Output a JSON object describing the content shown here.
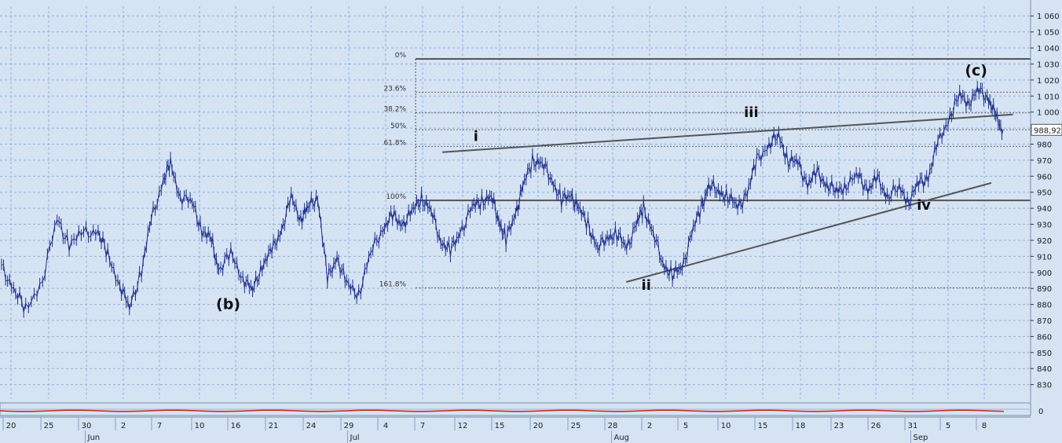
{
  "chart_data": {
    "type": "line",
    "y_axis": {
      "side": "right",
      "ylim": [
        821,
        1066
      ],
      "ticks": [
        830,
        840,
        850,
        860,
        870,
        880,
        890,
        900,
        910,
        920,
        930,
        940,
        950,
        960,
        970,
        980,
        990,
        1000,
        1010,
        1020,
        1030,
        1040,
        1050,
        1060
      ],
      "tick_labels": [
        "830",
        "840",
        "850",
        "860",
        "870",
        "880",
        "890",
        "900",
        "910",
        "920",
        "930",
        "940",
        "950",
        "960",
        "970",
        "980",
        "990",
        "1 000",
        "1 010",
        "1 020",
        "1 030",
        "1 040",
        "1 050",
        "1 060"
      ],
      "current_value_label": "988,92",
      "current_value": 988.92
    },
    "x_axis": {
      "day_ticks": [
        "20",
        "25",
        "30",
        "2",
        "7",
        "10",
        "16",
        "21",
        "24",
        "29",
        "4",
        "7",
        "12",
        "15",
        "20",
        "25",
        "28",
        "2",
        "5",
        "10",
        "15",
        "18",
        "23",
        "26",
        "31",
        "5",
        "8"
      ],
      "month_labels": [
        {
          "label": "Jun",
          "after_tick": 2
        },
        {
          "label": "Jul",
          "after_tick": 9
        },
        {
          "label": "Aug",
          "after_tick": 16
        },
        {
          "label": "Sep",
          "after_tick": 24
        }
      ]
    },
    "series": [
      {
        "values": [
          [
            0,
            903
          ],
          [
            0.5,
            890
          ],
          [
            1,
            876
          ],
          [
            1.7,
            896
          ],
          [
            2.3,
            933
          ],
          [
            2.8,
            918
          ],
          [
            3.4,
            924
          ],
          [
            4,
            926
          ],
          [
            4.4,
            910
          ],
          [
            4.9,
            893
          ],
          [
            5.3,
            877
          ],
          [
            5.8,
            902
          ],
          [
            6.2,
            932
          ],
          [
            6.7,
            958
          ],
          [
            7,
            967
          ],
          [
            7.4,
            948
          ],
          [
            7.9,
            943
          ],
          [
            8.3,
            927
          ],
          [
            8.7,
            919
          ],
          [
            9,
            902
          ],
          [
            9.5,
            911
          ],
          [
            10,
            897
          ],
          [
            10.4,
            888
          ],
          [
            10.8,
            905
          ],
          [
            11.2,
            913
          ],
          [
            11.6,
            927
          ],
          [
            12,
            946
          ],
          [
            12.4,
            934
          ],
          [
            12.7,
            940
          ],
          [
            13.1,
            948
          ],
          [
            13.5,
            895
          ],
          [
            13.9,
            910
          ],
          [
            14.3,
            892
          ],
          [
            14.8,
            887
          ],
          [
            15.3,
            912
          ],
          [
            15.8,
            928
          ],
          [
            16.2,
            935
          ],
          [
            16.6,
            930
          ],
          [
            17,
            937
          ],
          [
            17.4,
            947
          ],
          [
            17.8,
            938
          ],
          [
            18.2,
            920
          ],
          [
            18.6,
            913
          ],
          [
            19,
            925
          ],
          [
            19.5,
            940
          ],
          [
            19.9,
            945
          ],
          [
            20.3,
            947
          ],
          [
            20.6,
            933
          ],
          [
            20.9,
            920
          ],
          [
            21.3,
            937
          ],
          [
            21.6,
            953
          ],
          [
            22,
            970
          ],
          [
            22.4,
            968
          ],
          [
            22.8,
            958
          ],
          [
            23.2,
            945
          ],
          [
            23.6,
            948
          ],
          [
            23.9,
            940
          ],
          [
            24.3,
            930
          ],
          [
            24.7,
            915
          ],
          [
            25.1,
            922
          ],
          [
            25.5,
            924
          ],
          [
            25.9,
            915
          ],
          [
            26.3,
            930
          ],
          [
            26.6,
            940
          ],
          [
            27,
            925
          ],
          [
            27.4,
            905
          ],
          [
            27.8,
            899
          ],
          [
            28.2,
            902
          ],
          [
            28.6,
            925
          ],
          [
            29,
            940
          ],
          [
            29.3,
            955
          ],
          [
            29.7,
            950
          ],
          [
            30.1,
            948
          ],
          [
            30.5,
            940
          ],
          [
            30.9,
            950
          ],
          [
            31.3,
            970
          ],
          [
            31.8,
            980
          ],
          [
            32.2,
            985
          ],
          [
            32.6,
            970
          ],
          [
            33,
            968
          ],
          [
            33.4,
            955
          ],
          [
            33.8,
            962
          ],
          [
            34.2,
            955
          ],
          [
            34.6,
            950
          ],
          [
            35,
            955
          ],
          [
            35.5,
            960
          ],
          [
            35.9,
            952
          ],
          [
            36.3,
            958
          ],
          [
            36.7,
            948
          ],
          [
            37.2,
            952
          ],
          [
            37.6,
            945
          ],
          [
            38,
            955
          ],
          [
            38.4,
            960
          ],
          [
            38.8,
            980
          ],
          [
            39.3,
            998
          ],
          [
            39.7,
            1010
          ],
          [
            40.1,
            1007
          ],
          [
            40.5,
            1013
          ],
          [
            40.9,
            1009
          ],
          [
            41.2,
            996
          ],
          [
            41.5,
            989
          ]
        ]
      }
    ],
    "day_index_of_ticks": [
      0,
      5,
      10,
      15,
      20,
      23,
      29,
      34,
      37,
      42,
      47,
      50,
      55,
      58,
      63,
      68,
      71,
      76,
      79,
      84,
      89,
      92,
      97,
      100,
      105,
      110,
      113
    ],
    "wave_labels": [
      {
        "label": "(b)",
        "x_day": 15.4,
        "value": 877
      },
      {
        "label": "i",
        "x_day": 31.1,
        "value": 982
      },
      {
        "label": "ii",
        "x_day": 41.9,
        "value": 889
      },
      {
        "label": "iii",
        "x_day": 48.5,
        "value": 997
      },
      {
        "label": "iv",
        "x_day": 59.1,
        "value": 939
      },
      {
        "label": "(c)",
        "x_day": 62.3,
        "value": 1023
      }
    ],
    "fibonacci": {
      "levels": [
        {
          "label": "0%",
          "value": 1033.2
        },
        {
          "label": "23.6%",
          "value": 1012.4
        },
        {
          "label": "38.2%",
          "value": 999.5
        },
        {
          "label": "50%",
          "value": 989.0
        },
        {
          "label": "61.8%",
          "value": 978.6
        },
        {
          "label": "100%",
          "value": 944.9
        },
        {
          "label": "161.8%",
          "value": 890.4
        }
      ],
      "start_day": 50.3
    },
    "trendlines": [
      {
        "from": [
          29.1,
          975
        ],
        "to": [
          64,
          998.5
        ]
      },
      {
        "from": [
          40.4,
          894
        ],
        "to": [
          63,
          955.8
        ]
      }
    ],
    "colors": {
      "background": "#d5e3f3",
      "series": "#1f2f8f",
      "grid": "#8fb3dc",
      "trendline": "#555555",
      "lower_panel_line": "#cc2222"
    },
    "grid": true,
    "lower_panel": {
      "tick_label": "0"
    }
  }
}
